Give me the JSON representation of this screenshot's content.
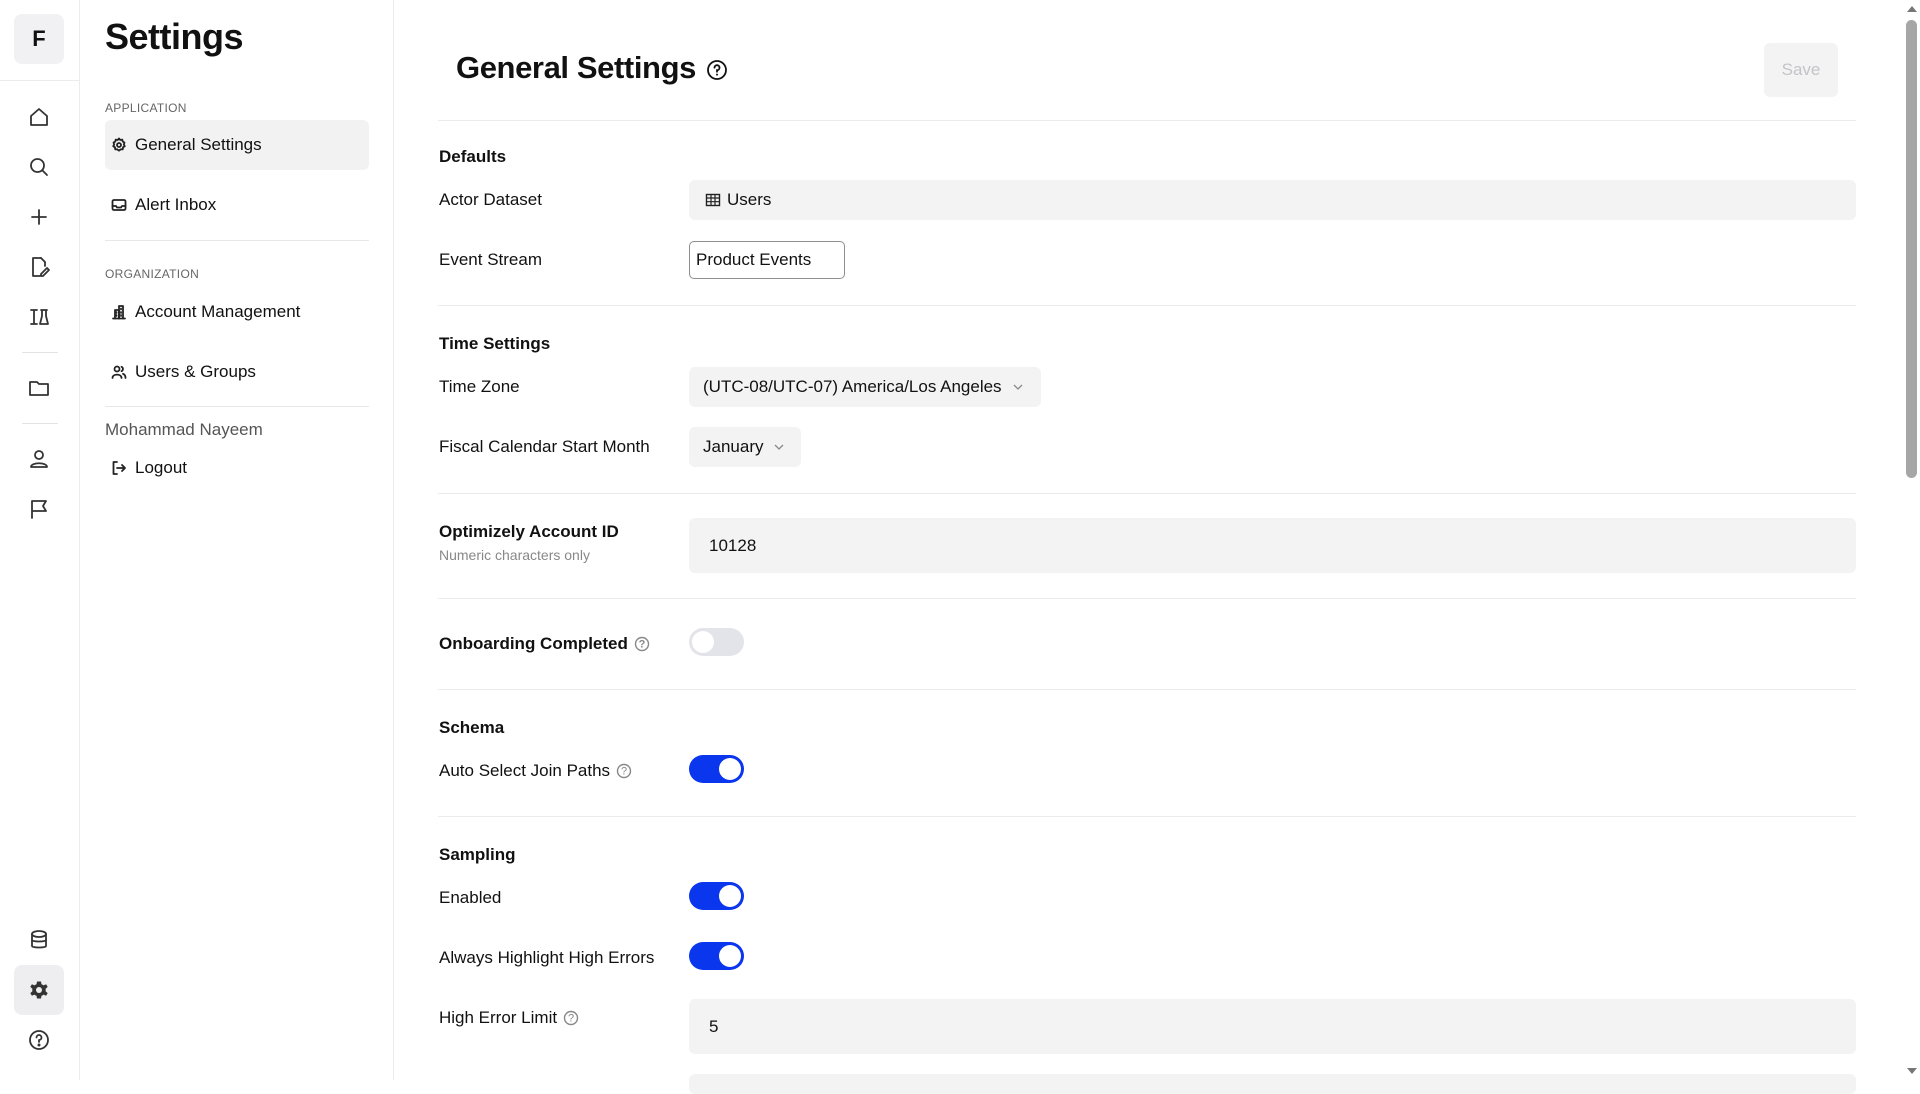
{
  "rail": {
    "logo_letter": "F",
    "icons": [
      "home-icon",
      "search-icon",
      "plus-icon",
      "edit-document-icon",
      "experiments-icon",
      "folder-icon",
      "person-icon",
      "flag-icon",
      "database-icon",
      "gear-icon",
      "help-icon"
    ]
  },
  "nav": {
    "title": "Settings",
    "section_application": "APPLICATION",
    "section_organization": "ORGANIZATION",
    "items": [
      {
        "label": "General Settings"
      },
      {
        "label": "Alert Inbox"
      },
      {
        "label": "Account Management"
      },
      {
        "label": "Users & Groups"
      }
    ],
    "user_name": "Mohammad Nayeem",
    "logout_label": "Logout"
  },
  "main": {
    "title": "General Settings",
    "save_label": "Save",
    "defaults": {
      "title": "Defaults",
      "actor_dataset_label": "Actor Dataset",
      "actor_dataset_value": "Users",
      "event_stream_label": "Event Stream",
      "event_stream_value": "Product Events"
    },
    "time": {
      "title": "Time Settings",
      "time_zone_label": "Time Zone",
      "time_zone_value": "(UTC-08/UTC-07) America/Los Angeles",
      "fiscal_label": "Fiscal Calendar Start Month",
      "fiscal_value": "January"
    },
    "optimizely": {
      "label": "Optimizely Account ID",
      "sublabel": "Numeric characters only",
      "value": "10128"
    },
    "onboarding": {
      "label": "Onboarding Completed",
      "enabled": false
    },
    "schema": {
      "title": "Schema",
      "auto_join_label": "Auto Select Join Paths",
      "auto_join_enabled": true
    },
    "sampling": {
      "title": "Sampling",
      "enabled_label": "Enabled",
      "enabled": true,
      "highlight_label": "Always Highlight High Errors",
      "highlight_enabled": true,
      "high_error_label": "High Error Limit",
      "high_error_value": "5"
    }
  },
  "colors": {
    "accent": "#0a36ee",
    "toggle_off": "#e3e4ea",
    "field_bg": "#f3f3f4"
  }
}
